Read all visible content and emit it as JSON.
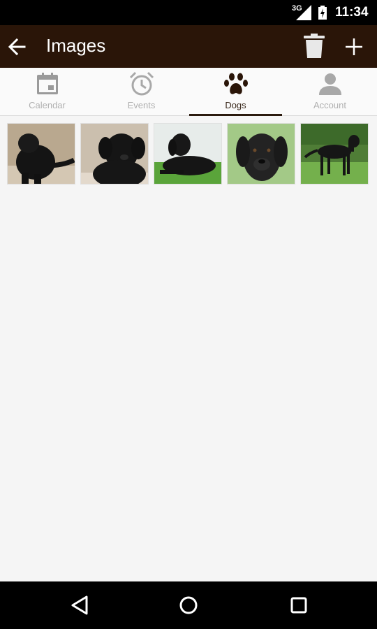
{
  "status_bar": {
    "network": "3G",
    "time": "11:34"
  },
  "app_bar": {
    "title": "Images",
    "back_icon": "arrow-left-icon",
    "delete_icon": "trash-icon",
    "add_icon": "plus-icon"
  },
  "tabs": [
    {
      "label": "Calendar",
      "icon": "calendar-icon",
      "active": false
    },
    {
      "label": "Events",
      "icon": "alarm-clock-icon",
      "active": false
    },
    {
      "label": "Dogs",
      "icon": "paw-icon",
      "active": true
    },
    {
      "label": "Account",
      "icon": "person-icon",
      "active": false
    }
  ],
  "images": [
    {
      "subject": "black labrador puppy sitting"
    },
    {
      "subject": "black labrador puppy close-up"
    },
    {
      "subject": "black labrador puppy lying on grass"
    },
    {
      "subject": "black labrador face portrait"
    },
    {
      "subject": "black labrador standing on grass"
    }
  ],
  "colors": {
    "app_bar": "#2a1508",
    "accent": "#2a1a0e",
    "inactive_tab": "#b0b0b0",
    "background": "#f5f5f5"
  },
  "nav_bar": {
    "back_icon": "triangle-back-icon",
    "home_icon": "circle-home-icon",
    "recents_icon": "square-recents-icon"
  }
}
